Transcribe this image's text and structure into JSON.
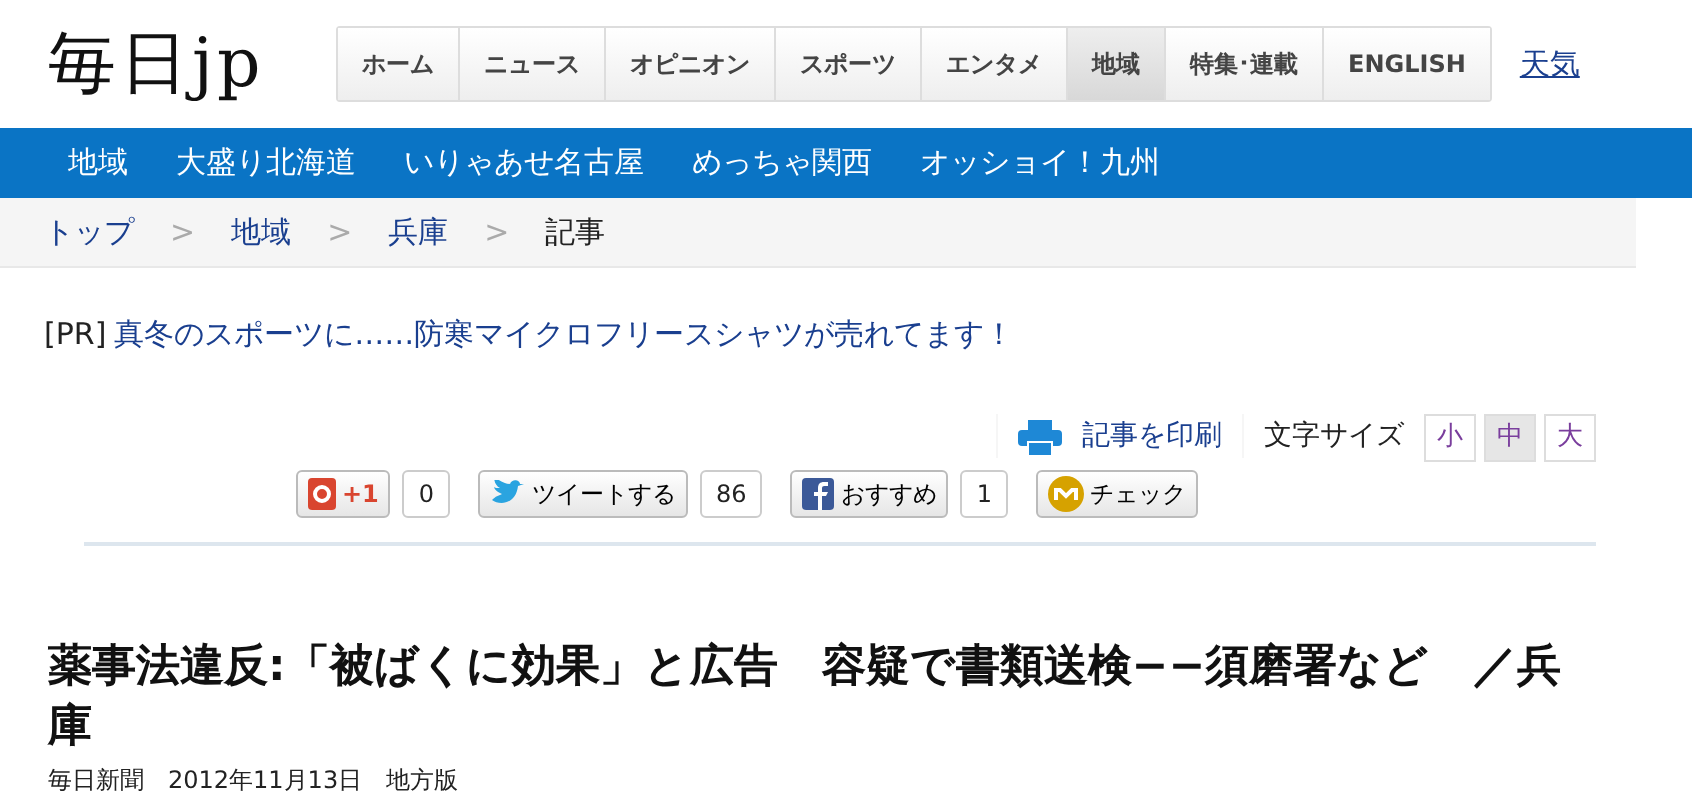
{
  "logo": "毎日jp",
  "nav": [
    {
      "label": "ホーム",
      "selected": false
    },
    {
      "label": "ニュース",
      "selected": false
    },
    {
      "label": "オピニオン",
      "selected": false
    },
    {
      "label": "スポーツ",
      "selected": false
    },
    {
      "label": "エンタメ",
      "selected": false
    },
    {
      "label": "地域",
      "selected": true
    },
    {
      "label": "特集･連載",
      "selected": false
    },
    {
      "label": "ENGLISH",
      "selected": false
    }
  ],
  "nav_extra": "天気",
  "subnav": [
    "地域",
    "大盛り北海道",
    "いりゃあせ名古屋",
    "めっちゃ関西",
    "オッショイ！九州"
  ],
  "breadcrumb": [
    {
      "label": "トップ",
      "kind": "link"
    },
    {
      "label": "地域",
      "kind": "link"
    },
    {
      "label": "兵庫",
      "kind": "link"
    },
    {
      "label": "記事",
      "kind": "current"
    }
  ],
  "breadcrumb_separator": ">",
  "pr": {
    "tag": "[PR]",
    "text": "真冬のスポーツに……防寒マイクロフリースシャツが売れてます！"
  },
  "print_link": "記事を印刷",
  "font_size": {
    "label": "文字サイズ",
    "options": [
      {
        "label": "小",
        "selected": false
      },
      {
        "label": "中",
        "selected": true
      },
      {
        "label": "大",
        "selected": false
      }
    ]
  },
  "social": [
    {
      "kind": "google",
      "label": "+1",
      "count": "0"
    },
    {
      "kind": "twitter",
      "label": "ツイートする",
      "count": "86"
    },
    {
      "kind": "facebook",
      "label": "おすすめ",
      "count": "1"
    },
    {
      "kind": "mixi",
      "label": "チェック"
    }
  ],
  "headline": "薬事法違反:「被ばくに効果」と広告　容疑で書類送検−−須磨署など　／兵庫",
  "byline": "毎日新聞　2012年11月13日　地方版"
}
